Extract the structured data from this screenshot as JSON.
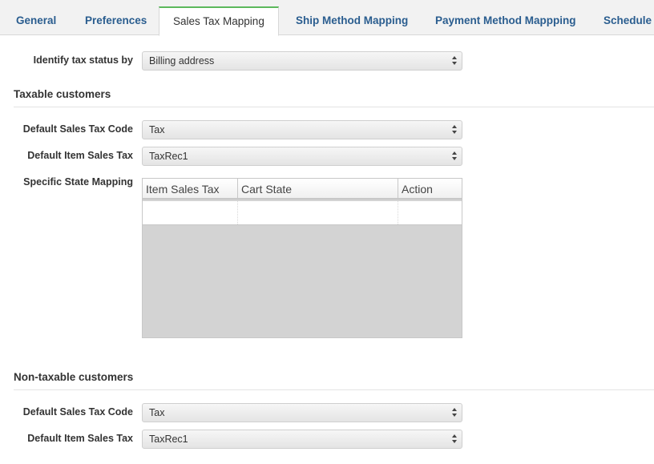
{
  "tabs": [
    {
      "label": "General"
    },
    {
      "label": "Preferences"
    },
    {
      "label": "Sales Tax Mapping",
      "active": true
    },
    {
      "label": "Ship Method Mapping"
    },
    {
      "label": "Payment Method Mappping"
    },
    {
      "label": "Schedule"
    }
  ],
  "identify": {
    "label": "Identify tax status by",
    "value": "Billing address"
  },
  "taxable": {
    "title": "Taxable customers",
    "tax_code": {
      "label": "Default Sales Tax Code",
      "value": "Tax"
    },
    "item_tax": {
      "label": "Default Item Sales Tax",
      "value": "TaxRec1"
    },
    "state_mapping": {
      "label": "Specific State Mapping",
      "columns": [
        "Item Sales Tax",
        "Cart State",
        "Action"
      ]
    }
  },
  "nontaxable": {
    "title": "Non-taxable customers",
    "tax_code": {
      "label": "Default Sales Tax Code",
      "value": "Tax"
    },
    "item_tax": {
      "label": "Default Item Sales Tax",
      "value": "TaxRec1"
    }
  },
  "colors": {
    "accent": "#5cb85c",
    "tab_link": "#2a5d8f",
    "grid_empty": "#d3d3d3"
  },
  "icons": {
    "select_arrows": "updown-chevron-icon"
  }
}
